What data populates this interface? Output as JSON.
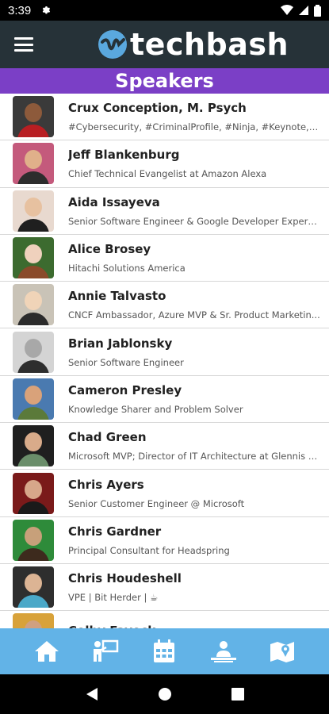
{
  "status_bar": {
    "time": "3:39"
  },
  "app": {
    "brand": "techbash"
  },
  "section": {
    "title": "Speakers"
  },
  "speakers": [
    {
      "name": "Crux Conception, M. Psych",
      "title": "#Cybersecurity, #CriminalProfile, #Ninja, #Keynote, #S...",
      "bg": "#3a3a3a",
      "skin": "#8d5a3b",
      "shirt": "#b81e22"
    },
    {
      "name": "Jeff Blankenburg",
      "title": "Chief Technical Evangelist at Amazon Alexa",
      "bg": "#c45a7c",
      "skin": "#e0b08a",
      "shirt": "#2d2d2d"
    },
    {
      "name": "Aida Issayeva",
      "title": "Senior Software Engineer & Google Developer Expert fo...",
      "bg": "#e8d9cf",
      "skin": "#e7c1a0",
      "shirt": "#1f1f1f"
    },
    {
      "name": "Alice Brosey",
      "title": "Hitachi Solutions America",
      "bg": "#3c6b2f",
      "skin": "#efd1bd",
      "shirt": "#8a4a2a"
    },
    {
      "name": "Annie Talvasto",
      "title": "CNCF Ambassador, Azure MVP & Sr. Product Marketin...",
      "bg": "#c9c3b7",
      "skin": "#f0d4b8",
      "shirt": "#2b2b2b"
    },
    {
      "name": "Brian Jablonsky",
      "title": "Senior Software Engineer",
      "bg": "#d4d4d4",
      "skin": "#a8a8a8",
      "shirt": "#2e2e2e"
    },
    {
      "name": "Cameron Presley",
      "title": "Knowledge Sharer and Problem Solver",
      "bg": "#4a7ab0",
      "skin": "#d9a27a",
      "shirt": "#5b7a3a"
    },
    {
      "name": "Chad Green",
      "title": "Microsoft MVP; Director of IT Architecture at Glennis S...",
      "bg": "#1f1f1f",
      "skin": "#d9ab8a",
      "shirt": "#6a8e6a"
    },
    {
      "name": "Chris Ayers",
      "title": "Senior Customer Engineer @ Microsoft",
      "bg": "#7a1a1a",
      "skin": "#d7a78a",
      "shirt": "#1a1a1a"
    },
    {
      "name": "Chris Gardner",
      "title": "Principal Consultant for Headspring",
      "bg": "#2e8b3a",
      "skin": "#c7a07a",
      "shirt": "#3d2a1d"
    },
    {
      "name": "Chris Houdeshell",
      "title": "VPE | Bit Herder | ☕",
      "bg": "#2e2e2e",
      "skin": "#dcb494",
      "shirt": "#4aa8c8"
    },
    {
      "name": "Colby Fayock",
      "title": "",
      "bg": "#d8a23a",
      "skin": "#d0a080",
      "shirt": "#3a3a3a"
    }
  ],
  "icons": {
    "menu": "menu-icon",
    "home": "home-icon",
    "speakers": "speaker-podium-icon",
    "schedule": "calendar-icon",
    "sponsors": "person-laptop-icon",
    "map": "map-icon"
  },
  "colors": {
    "app_bar": "#263238",
    "section_bar": "#7b3fc6",
    "bottom_nav": "#62b3e7"
  }
}
